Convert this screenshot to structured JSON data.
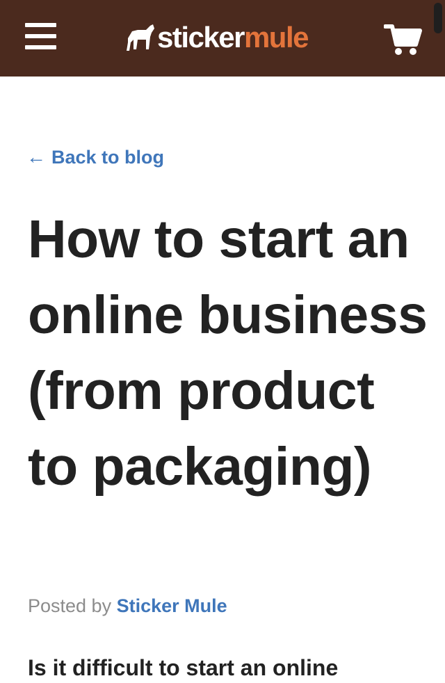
{
  "header": {
    "menu_icon": "hamburger-menu-icon",
    "logo": {
      "icon": "mule-icon",
      "word_part1": "sticker",
      "word_part2": "mule"
    },
    "cart_icon": "shopping-cart-icon"
  },
  "colors": {
    "header_bg": "#4b2a1e",
    "logo_accent": "#e3743b",
    "link": "#3f76ba",
    "title": "#222222",
    "muted": "#8c8c8c"
  },
  "article": {
    "back_arrow": "←",
    "back_label": "Back to blog",
    "title": "How to start an online business (from product to packaging)",
    "byline_prefix": "Posted by",
    "author": "Sticker Mule",
    "intro_partial": "Is it difficult to start an online"
  }
}
